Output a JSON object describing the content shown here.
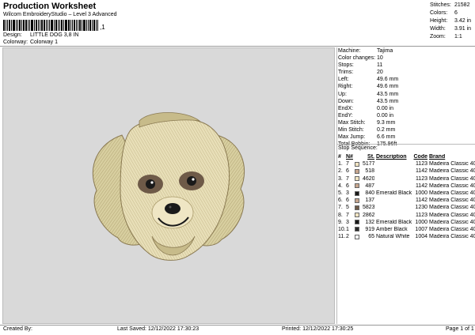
{
  "header": {
    "title": "Production Worksheet",
    "subtitle": "Wilcom EmbroideryStudio – Level 3 Advanced",
    "barcode_suffix": ",1",
    "design_label": "Design:",
    "design_value": "LITTLE DOG 3,8 IN",
    "colorway_label": "Colorway:",
    "colorway_value": "Colorway 1"
  },
  "stats": [
    {
      "label": "Stitches:",
      "value": "21582"
    },
    {
      "label": "Colors:",
      "value": "6"
    },
    {
      "label": "Height:",
      "value": "3.42 in"
    },
    {
      "label": "Width:",
      "value": "3.91 in"
    },
    {
      "label": "Zoom:",
      "value": "1:1"
    }
  ],
  "machine": [
    {
      "label": "Machine:",
      "value": "Tajima"
    },
    {
      "label": "Color changes:",
      "value": "10"
    },
    {
      "label": "Stops:",
      "value": "11"
    },
    {
      "label": "Trims:",
      "value": "20"
    },
    {
      "label": "Left:",
      "value": "49.6 mm"
    },
    {
      "label": "Right:",
      "value": "49.6 mm"
    },
    {
      "label": "Up:",
      "value": "43.5 mm"
    },
    {
      "label": "Down:",
      "value": "43.5 mm"
    },
    {
      "label": "EndX:",
      "value": "0.00 in"
    },
    {
      "label": "EndY:",
      "value": "0.00 in"
    },
    {
      "label": "Max Stitch:",
      "value": "9.3 mm"
    },
    {
      "label": "Min Stitch:",
      "value": "0.2 mm"
    },
    {
      "label": "Max Jump:",
      "value": "6.6 mm"
    },
    {
      "label": "Total Bobbin:",
      "value": "175.96ft"
    }
  ],
  "stop_sequence": {
    "title": "Stop Sequence:",
    "headers": {
      "num": "#",
      "n": "N#",
      "st": "St.",
      "desc": "Description",
      "code": "Code",
      "brand": "Brand"
    },
    "rows": [
      {
        "num": "1.",
        "n": "7",
        "color": "#f0e4c2",
        "st": "5177",
        "desc": "",
        "code": "1123",
        "brand": "Madeira Classic 40"
      },
      {
        "num": "2.",
        "n": "6",
        "color": "#c6a58e",
        "st": "518",
        "desc": "",
        "code": "1142",
        "brand": "Madeira Classic 40"
      },
      {
        "num": "3.",
        "n": "7",
        "color": "#f0e4c2",
        "st": "4620",
        "desc": "",
        "code": "1123",
        "brand": "Madeira Classic 40"
      },
      {
        "num": "4.",
        "n": "6",
        "color": "#c6a58e",
        "st": "487",
        "desc": "",
        "code": "1142",
        "brand": "Madeira Classic 40"
      },
      {
        "num": "5.",
        "n": "3",
        "color": "#1a1a1a",
        "st": "840",
        "desc": "Emerald Black",
        "code": "1000",
        "brand": "Madeira Classic 40"
      },
      {
        "num": "6.",
        "n": "6",
        "color": "#c6a58e",
        "st": "137",
        "desc": "",
        "code": "1142",
        "brand": "Madeira Classic 40"
      },
      {
        "num": "7.",
        "n": "5",
        "color": "#6e5a48",
        "st": "5823",
        "desc": "",
        "code": "1230",
        "brand": "Madeira Classic 40"
      },
      {
        "num": "8.",
        "n": "7",
        "color": "#f0e4c2",
        "st": "2862",
        "desc": "",
        "code": "1123",
        "brand": "Madeira Classic 40"
      },
      {
        "num": "9.",
        "n": "3",
        "color": "#1a1a1a",
        "st": "132",
        "desc": "Emerald Black",
        "code": "1000",
        "brand": "Madeira Classic 40"
      },
      {
        "num": "10.",
        "n": "1",
        "color": "#2b2b2b",
        "st": "919",
        "desc": "Amber Black",
        "code": "1007",
        "brand": "Madeira Classic 40"
      },
      {
        "num": "11.",
        "n": "2",
        "color": "#f4f4f4",
        "st": "65",
        "desc": "Natural White",
        "code": "1004",
        "brand": "Madeira Classic 40"
      }
    ]
  },
  "footer": {
    "created_by": "Created By:",
    "last_saved": "Last Saved: 12/12/2022 17:30:23",
    "printed": "Printed: 12/12/2022 17:30:25",
    "page": "Page 1 of 1"
  },
  "colors": {
    "canvas_bg": "#d9d9d9",
    "fur_light": "#d8cfa0",
    "fur_mid": "#b7a877",
    "fur_dark": "#7a6a4a",
    "eye_patch": "#6e5a48"
  }
}
